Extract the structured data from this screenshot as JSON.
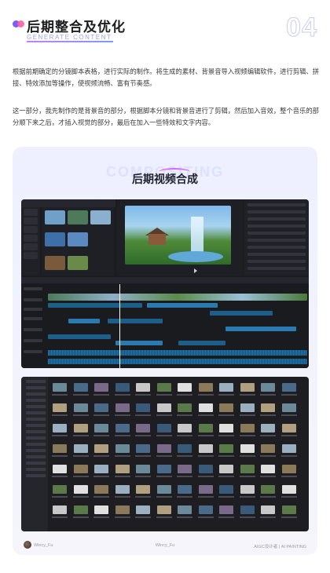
{
  "header": {
    "title": "后期整合及优化",
    "subtitle": "GENERATE CONTENT",
    "section_number": "04"
  },
  "paragraphs": {
    "p1": "根据前期确定的分镜脚本表格，进行实际的制作。将生成的素材、背景音导入视频编辑软件，进行剪辑、拼接、特效添加等操作，使视频流畅、富有节奏感。",
    "p2": "这一部分，我先制作的是背景音的部分，根据脚本分镜和背景音进行了剪辑，然后加入音效，整个音乐的部分顺下来之后，才插入视觉的部分，最后在加入一些特效和文字内容。"
  },
  "card": {
    "title_shadow": "COMPOSITING",
    "title": "后期视频合成"
  },
  "footer": {
    "author": "Wincy_Fu",
    "center": "Wincy_Fu",
    "right": "AIGC设计者 | AI PAINTING"
  },
  "colors": {
    "accent_purple": "#7b5cff",
    "accent_pink": "#ff5fa2",
    "editor_bg": "#1b1c20"
  }
}
